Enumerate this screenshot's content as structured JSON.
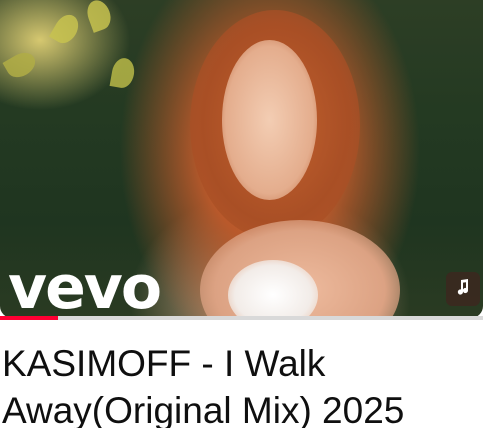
{
  "video": {
    "channel_logo_text": "vevo",
    "title": "KASIMOFF - I Walk Away(Original Mix) 2025",
    "watch_progress": 0.12,
    "badge_icon": "music-note-icon"
  },
  "colors": {
    "progress_fill": "#ff0033",
    "progress_track": "#d9d9d9",
    "title_text": "#0f0f0f"
  }
}
